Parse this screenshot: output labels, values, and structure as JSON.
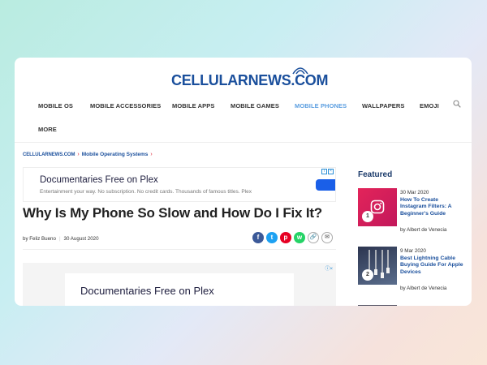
{
  "site": {
    "logo_part1": "CELLULAR",
    "logo_part2": "NEWS.COM",
    "brand_color": "#1a4f9c"
  },
  "nav": {
    "items": [
      {
        "label": "MOBILE OS",
        "active": false
      },
      {
        "label": "MOBILE ACCESSORIES",
        "active": false
      },
      {
        "label": "MOBILE APPS",
        "active": false
      },
      {
        "label": "MOBILE GAMES",
        "active": false
      },
      {
        "label": "MOBILE PHONES",
        "active": true
      },
      {
        "label": "WALLPAPERS",
        "active": false
      },
      {
        "label": "EMOJI",
        "active": false
      },
      {
        "label": "MORE",
        "active": false
      }
    ],
    "active_color": "#5b9ee0",
    "search_icon": "search-icon"
  },
  "breadcrumb": {
    "home_logo_part1": "CELLULAR",
    "home_logo_part2": "NEWS.COM",
    "category": "Mobile Operating Systems",
    "sep": "›"
  },
  "ad_top": {
    "title": "Documentaries Free on Plex",
    "subtitle": "Entertainment your way. No subscription. No credit cards. Thousands of famous titles. Plex"
  },
  "article": {
    "title": "Why Is My Phone So Slow and How Do I Fix It?",
    "byline": "by Feliz Bueno",
    "date": "30 August 2020"
  },
  "share": {
    "facebook": "f",
    "twitter": "t",
    "pinterest": "p",
    "whatsapp": "w",
    "link": "🔗",
    "email": "✉"
  },
  "ad_bottom": {
    "title": "Documentaries Free on Plex"
  },
  "featured": {
    "heading": "Featured",
    "items": [
      {
        "rank": "1",
        "date": "30 Mar 2020",
        "title": "How To Create Instagram Filters: A Beginner's Guide",
        "author": "by Albert de Venecia",
        "thumb_color": "#e0245e"
      },
      {
        "rank": "2",
        "date": "9 Mar 2020",
        "title": "Best Lightning Cable Buying Guide For Apple Devices",
        "author": "by Albert de Venecia",
        "thumb_color": "#3a4a6a"
      }
    ]
  }
}
